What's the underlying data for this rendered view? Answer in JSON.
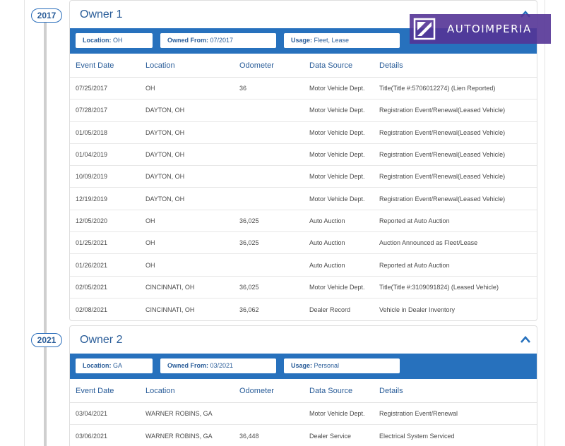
{
  "owners": [
    {
      "year": "2017",
      "title": "Owner 1",
      "location_label": "Location:",
      "location_value": "OH",
      "owned_from_label": "Owned From:",
      "owned_from_value": "07/2017",
      "usage_label": "Usage:",
      "usage_value": "Fleet, Lease",
      "columns": [
        "Event Date",
        "Location",
        "Odometer",
        "Data Source",
        "Details"
      ],
      "rows": [
        [
          "07/25/2017",
          "OH",
          "36",
          "Motor Vehicle Dept.",
          "Title(Title #:5706012274) (Lien Reported)"
        ],
        [
          "07/28/2017",
          "DAYTON, OH",
          "",
          "Motor Vehicle Dept.",
          "Registration Event/Renewal(Leased Vehicle)"
        ],
        [
          "01/05/2018",
          "DAYTON, OH",
          "",
          "Motor Vehicle Dept.",
          "Registration Event/Renewal(Leased Vehicle)"
        ],
        [
          "01/04/2019",
          "DAYTON, OH",
          "",
          "Motor Vehicle Dept.",
          "Registration Event/Renewal(Leased Vehicle)"
        ],
        [
          "10/09/2019",
          "DAYTON, OH",
          "",
          "Motor Vehicle Dept.",
          "Registration Event/Renewal(Leased Vehicle)"
        ],
        [
          "12/19/2019",
          "DAYTON, OH",
          "",
          "Motor Vehicle Dept.",
          "Registration Event/Renewal(Leased Vehicle)"
        ],
        [
          "12/05/2020",
          "OH",
          "36,025",
          "Auto Auction",
          "Reported at Auto Auction"
        ],
        [
          "01/25/2021",
          "OH",
          "36,025",
          "Auto Auction",
          "Auction Announced as Fleet/Lease"
        ],
        [
          "01/26/2021",
          "OH",
          "",
          "Auto Auction",
          "Reported at Auto Auction"
        ],
        [
          "02/05/2021",
          "CINCINNATI, OH",
          "36,025",
          "Motor Vehicle Dept.",
          "Title(Title #:3109091824) (Leased Vehicle)"
        ],
        [
          "02/08/2021",
          "CINCINNATI, OH",
          "36,062",
          "Dealer Record",
          "Vehicle in Dealer Inventory"
        ]
      ]
    },
    {
      "year": "2021",
      "title": "Owner 2",
      "location_label": "Location:",
      "location_value": "GA",
      "owned_from_label": "Owned From:",
      "owned_from_value": "03/2021",
      "usage_label": "Usage:",
      "usage_value": "Personal",
      "columns": [
        "Event Date",
        "Location",
        "Odometer",
        "Data Source",
        "Details"
      ],
      "rows": [
        [
          "03/04/2021",
          "WARNER ROBINS, GA",
          "",
          "Motor Vehicle Dept.",
          "Registration Event/Renewal"
        ],
        [
          "03/06/2021",
          "WARNER ROBINS, GA",
          "36,448",
          "Dealer Service",
          "Electrical System Serviced"
        ]
      ]
    }
  ],
  "watermark": {
    "text": "AUTOIMPERIA",
    "color": "#543496"
  },
  "colors": {
    "accent": "#2771bd",
    "title": "#2a5d99"
  }
}
